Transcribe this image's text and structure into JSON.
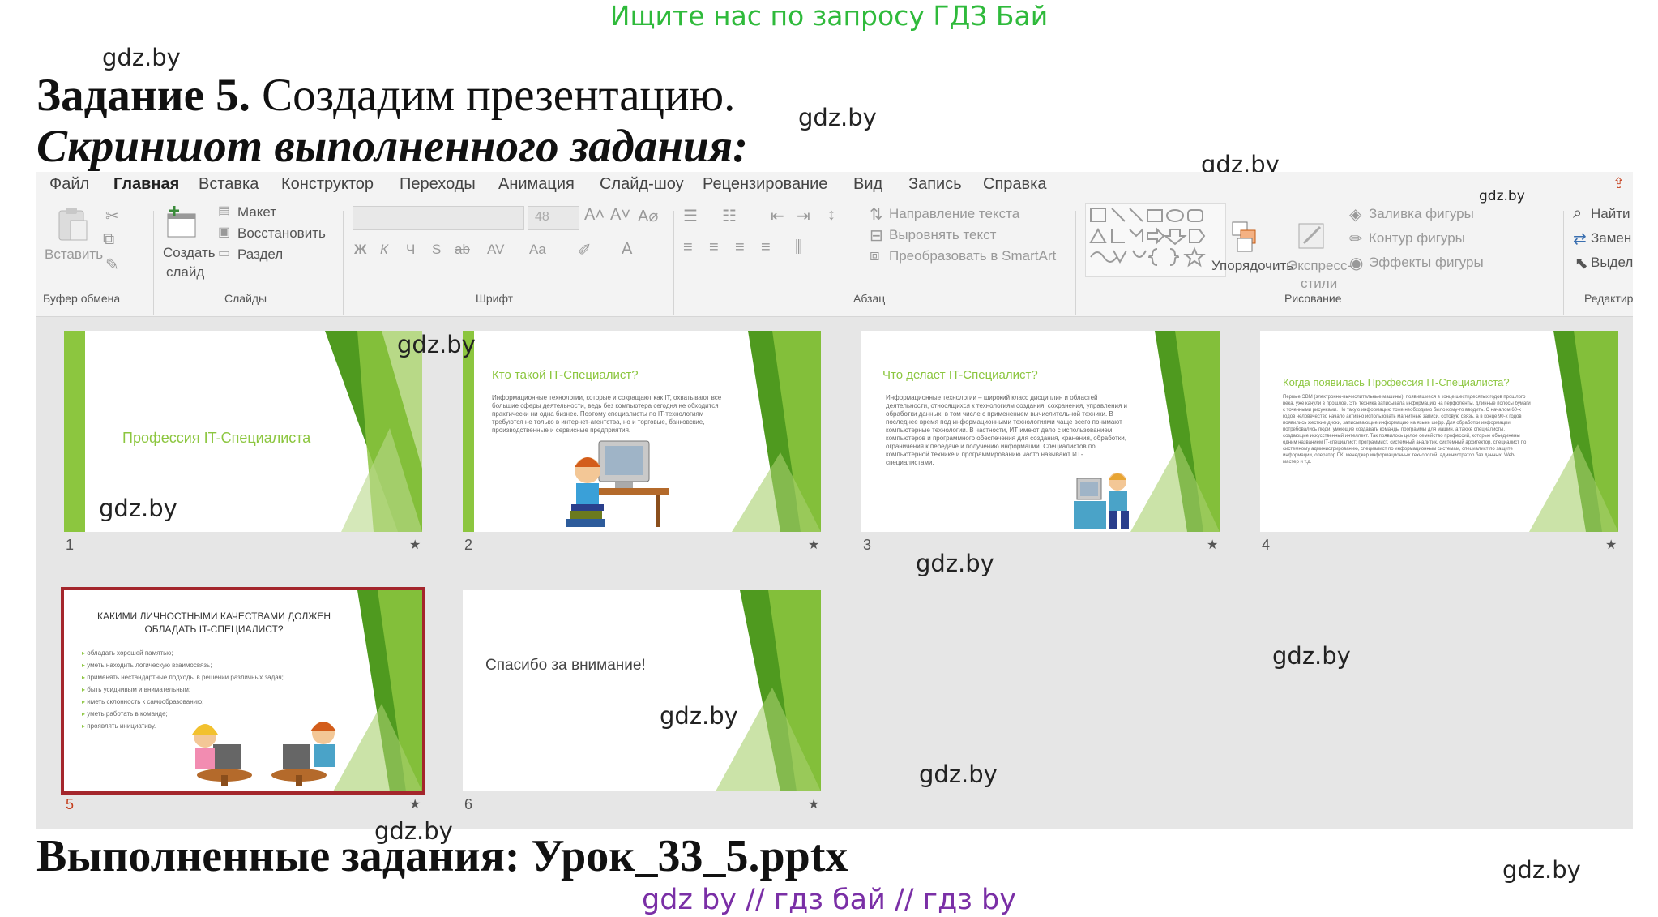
{
  "promo": "Ищите нас по запросу ГДЗ Бай",
  "watermark": "gdz.by",
  "task": {
    "title_bold": "Задание 5.",
    "title_rest": " Создадим презентацию.",
    "subtitle": "Скриншот выполненного задания:",
    "done": "Выполненные задания: Урок_33_5.pptx"
  },
  "footer": "gdz by  //  гдз бай  //  гдз by",
  "app": {
    "tabs": [
      "Файл",
      "Главная",
      "Вставка",
      "Конструктор",
      "Переходы",
      "Анимация",
      "Слайд-шоу",
      "Рецензирование",
      "Вид",
      "Запись",
      "Справка"
    ],
    "active_tab": "Главная",
    "ribbon": {
      "paste": "Вставить",
      "clipboard_group": "Буфер обмена",
      "new_slide_line1": "Создать",
      "new_slide_line2": "слайд",
      "layout": "Макет",
      "reset": "Восстановить",
      "section": "Раздел",
      "slides_group": "Слайды",
      "font_size": "48",
      "font_group": "Шрифт",
      "bold": "Ж",
      "italic": "К",
      "underline": "Ч",
      "shadow": "S",
      "strike": "ab",
      "spacing": "AV",
      "case": "Aa",
      "text_direction": "Направление текста",
      "align_text": "Выровнять текст",
      "smartart": "Преобразовать в SmartArt",
      "paragraph_group": "Абзац",
      "arrange": "Упорядочить",
      "quick_styles_line1": "Экспресс-",
      "quick_styles_line2": "стили",
      "shape_fill": "Заливка фигуры",
      "shape_outline": "Контур фигуры",
      "shape_effects": "Эффекты фигуры",
      "drawing_group": "Рисование",
      "find": "Найти",
      "replace": "Замен",
      "select": "Выдел",
      "editing_group": "Редактир"
    }
  },
  "slides": [
    {
      "num": "1",
      "title": "Профессия IT-Специалиста"
    },
    {
      "num": "2",
      "title": "Кто такой IT-Специалист?",
      "body": "Информационные технологии, которые и сокращают как IT, охватывают все большие сферы деятельности, ведь без компьютера сегодня не обходится практически ни одна бизнес. Поэтому специалисты по IT-технологиям требуются не только в интернет-агентства, но и торговые, банковские, производственные и сервисные предприятия."
    },
    {
      "num": "3",
      "title": "Что делает IT-Специалист?",
      "body": "Информационные технологии – широкий класс дисциплин и областей деятельности, относящихся к технологиям создания, сохранения, управления и обработки данных, в том числе с применением вычислительной техники. В последнее время под информационными технологиями чаще всего понимают компьютерные технологии. В частности, ИТ имеют дело с использованием компьютеров и программного обеспечения для создания, хранения, обработки, ограничения к передаче и получению информации. Специалистов по компьютерной технике и программированию часто называют ИТ-специалистами."
    },
    {
      "num": "4",
      "title": "Когда появилась Профессия IT-Специалиста?",
      "body": "Первые ЭВМ (электронно-вычислительные машины), появившиеся в конце шестидесятых годов прошлого века, уже канули в прошлое. Эти техника записывала информацию на перфоленты, длинные полосы бумаги с точечными рисунками. Но такую информацию тоже необходимо было кому-то вводить. С началом 60-х годов человечество начало активно использовать магнитные записи, сотовую связь, а в конце 90-х годов появились жесткие диски, записывающие информацию на языке цифр. Для обработки информации потребовались люди, умеющие создавать команды программы для машин, а также специалисты, создающие искусственный интеллект. Так появилось целое семейство профессий, которые объединены одним названием IT-специалист: программист, системный аналитик, системный архитектор, специалист по системному администрированию, специалист по информационным системам, специалист по защите информации, оператор ПК, менеджер информационных технологий, администратор баз данных, Web-мастер и т.д."
    },
    {
      "num": "5",
      "title": "КАКИМИ ЛИЧНОСТНЫМИ КАЧЕСТВАМИ ДОЛЖЕН ОБЛАДАТЬ IT-СПЕЦИАЛИСТ?",
      "bullets": [
        "обладать хорошей памятью;",
        "уметь находить логическую взаимосвязь;",
        "применять нестандартные подходы в решении различных задач;",
        "быть усидчивым и внимательным;",
        "иметь склонность к самообразованию;",
        "уметь работать в команде;",
        "проявлять инициативу."
      ]
    },
    {
      "num": "6",
      "title": "Спасибо за внимание!"
    }
  ],
  "colors": {
    "accent_green": "#8cc63f",
    "dark_green": "#4f9a1f",
    "selection": "#a4262c",
    "promo_green": "#2fba3b",
    "footer_purple": "#7a2fa6",
    "active_tab_underline": "#c43e1c"
  }
}
